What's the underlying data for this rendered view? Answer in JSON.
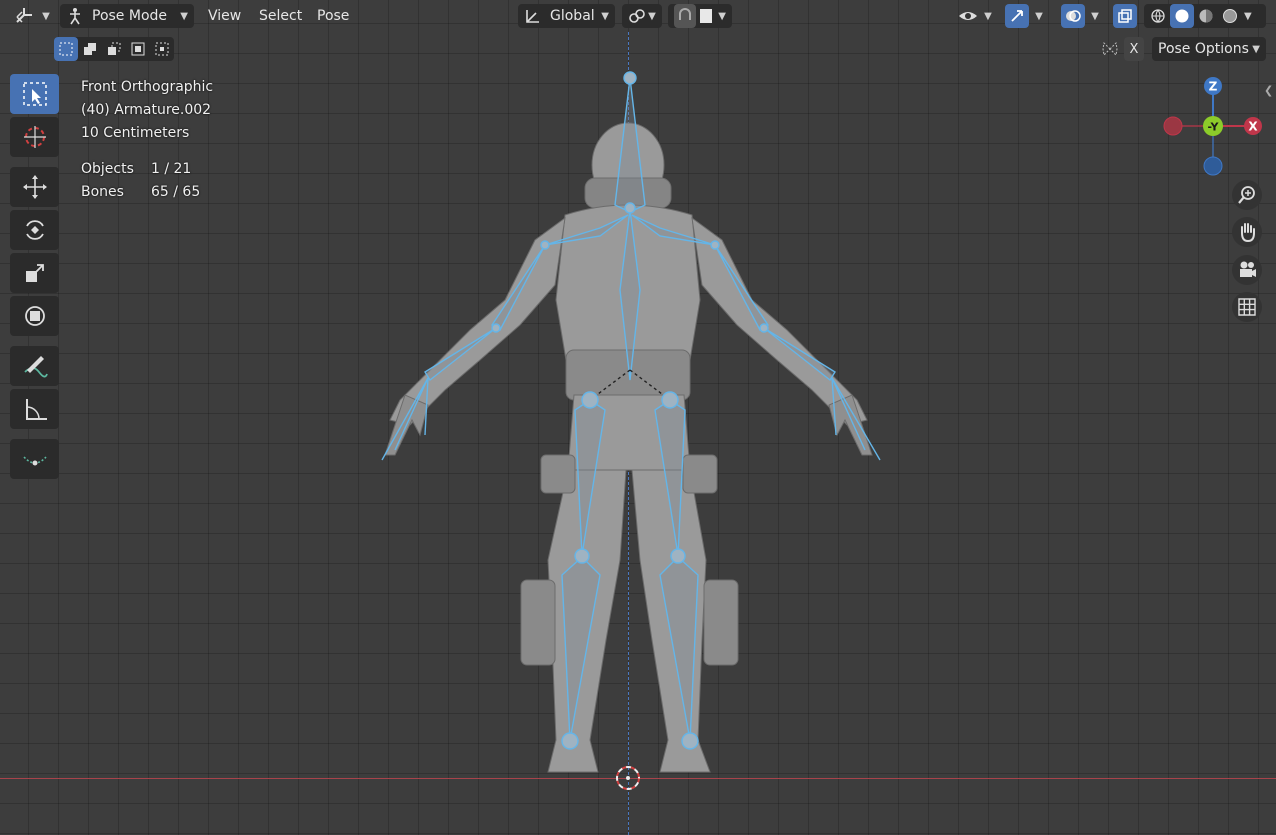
{
  "header": {
    "mode_label": "Pose Mode",
    "menus": [
      "View",
      "Select",
      "Pose"
    ],
    "transform_orientation": "Global",
    "pose_options_label": "Pose Options",
    "x_mirror_label": "X"
  },
  "overlay": {
    "view_name": "Front Orthographic",
    "object_name": "(40) Armature.002",
    "grid_scale": "10 Centimeters",
    "objects_label": "Objects",
    "objects_value": "1 / 21",
    "bones_label": "Bones",
    "bones_value": "65 / 65"
  },
  "gizmo": {
    "z_label": "Z",
    "y_label": "-Y",
    "x_label": "X"
  },
  "tools": [
    "select-box",
    "cursor",
    "move",
    "rotate",
    "scale",
    "transform",
    "annotate",
    "measure",
    "relax-pose"
  ],
  "colors": {
    "accent": "#4772b3",
    "bone": "#64b5e8",
    "x_axis": "#c0364a",
    "y_axis": "#8ccc2a",
    "z_axis": "#3f78c6"
  }
}
